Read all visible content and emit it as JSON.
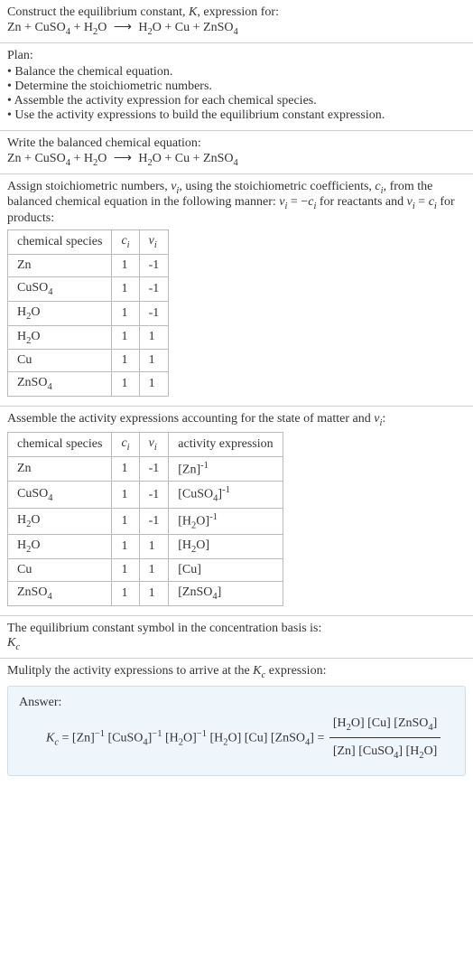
{
  "intro": {
    "line1": "Construct the equilibrium constant, ",
    "K": "K",
    "line1b": ", expression for:",
    "eq_lhs": "Zn + CuSO",
    "eq_lhs2": " + H",
    "eq_lhs3": "O",
    "eq_rhs": "H",
    "eq_rhs2": "O + Cu + ZnSO"
  },
  "plan": {
    "title": "Plan:",
    "items": [
      "Balance the chemical equation.",
      "Determine the stoichiometric numbers.",
      "Assemble the activity expression for each chemical species.",
      "Use the activity expressions to build the equilibrium constant expression."
    ]
  },
  "balanced": {
    "title": "Write the balanced chemical equation:"
  },
  "stoich": {
    "text1": "Assign stoichiometric numbers, ",
    "nu": "ν",
    "text2": ", using the stoichiometric coefficients, ",
    "c": "c",
    "text3": ", from the balanced chemical equation in the following manner: ",
    "text4": " for reactants and ",
    "text5": " for products:",
    "eq_reactants": " = −",
    "eq_products": " = ",
    "headers": [
      "chemical species",
      "cᵢ",
      "νᵢ"
    ],
    "h0": "chemical species",
    "rows": [
      {
        "sp": "Zn",
        "c": "1",
        "v": "-1"
      },
      {
        "sp": "CuSO₄",
        "c": "1",
        "v": "-1"
      },
      {
        "sp": "H₂O",
        "c": "1",
        "v": "-1"
      },
      {
        "sp": "H₂O",
        "c": "1",
        "v": "1"
      },
      {
        "sp": "Cu",
        "c": "1",
        "v": "1"
      },
      {
        "sp": "ZnSO₄",
        "c": "1",
        "v": "1"
      }
    ]
  },
  "activity": {
    "title": "Assemble the activity expressions accounting for the state of matter and ",
    "title_end": ":",
    "h0": "chemical species",
    "h3": "activity expression",
    "rows": [
      {
        "sp": "Zn",
        "c": "1",
        "v": "-1",
        "a": "[Zn]⁻¹"
      },
      {
        "sp": "CuSO₄",
        "c": "1",
        "v": "-1",
        "a": "[CuSO₄]⁻¹"
      },
      {
        "sp": "H₂O",
        "c": "1",
        "v": "-1",
        "a": "[H₂O]⁻¹"
      },
      {
        "sp": "H₂O",
        "c": "1",
        "v": "1",
        "a": "[H₂O]"
      },
      {
        "sp": "Cu",
        "c": "1",
        "v": "1",
        "a": "[Cu]"
      },
      {
        "sp": "ZnSO₄",
        "c": "1",
        "v": "1",
        "a": "[ZnSO₄]"
      }
    ]
  },
  "symbol": {
    "line": "The equilibrium constant symbol in the concentration basis is:",
    "Kc": "K",
    "c": "c"
  },
  "multiply": {
    "line": "Mulitply the activity expressions to arrive at the ",
    "line_end": " expression:"
  },
  "answer": {
    "label": "Answer:",
    "lhs_K": "K",
    "lhs_c": "c",
    "eq": " = [Zn]",
    "m1": "−1",
    "sp": " [CuSO",
    "sp2": "]",
    "sp3": " [H",
    "sp4": "O]",
    "prod": " [H",
    "prod2": "O] [Cu] [ZnSO",
    "prod3": "] = ",
    "num": "[H₂O] [Cu] [ZnSO₄]",
    "den": "[Zn] [CuSO₄] [H₂O]"
  },
  "chart_data": {
    "type": "table",
    "tables": [
      {
        "title": "Stoichiometric numbers",
        "headers": [
          "chemical species",
          "c_i",
          "ν_i"
        ],
        "rows": [
          [
            "Zn",
            1,
            -1
          ],
          [
            "CuSO4",
            1,
            -1
          ],
          [
            "H2O",
            1,
            -1
          ],
          [
            "H2O",
            1,
            1
          ],
          [
            "Cu",
            1,
            1
          ],
          [
            "ZnSO4",
            1,
            1
          ]
        ]
      },
      {
        "title": "Activity expressions",
        "headers": [
          "chemical species",
          "c_i",
          "ν_i",
          "activity expression"
        ],
        "rows": [
          [
            "Zn",
            1,
            -1,
            "[Zn]^-1"
          ],
          [
            "CuSO4",
            1,
            -1,
            "[CuSO4]^-1"
          ],
          [
            "H2O",
            1,
            -1,
            "[H2O]^-1"
          ],
          [
            "H2O",
            1,
            1,
            "[H2O]"
          ],
          [
            "Cu",
            1,
            1,
            "[Cu]"
          ],
          [
            "ZnSO4",
            1,
            1,
            "[ZnSO4]"
          ]
        ]
      }
    ]
  }
}
